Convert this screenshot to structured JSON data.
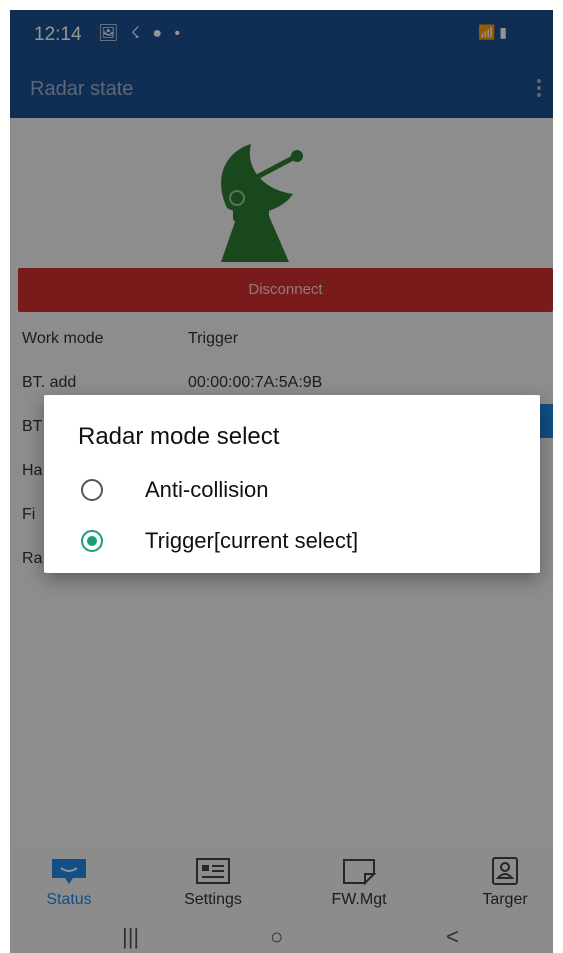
{
  "statusbar": {
    "time": "12:14",
    "left_icons": "🖼 ☇ ● •",
    "right_icons": "📶 ▮"
  },
  "appbar": {
    "title": "Radar state"
  },
  "radar": {
    "disconnect_label": "Disconnect"
  },
  "info": [
    {
      "label": "Work mode",
      "value": "Trigger"
    },
    {
      "label": "BT. add",
      "value": "00:00:00:7A:5A:9B"
    },
    {
      "label": "BT",
      "value": ""
    },
    {
      "label": "Ha",
      "value": ""
    },
    {
      "label": "Fi",
      "value": ""
    },
    {
      "label": "Ra",
      "value": ""
    }
  ],
  "dialog": {
    "title": "Radar mode select",
    "options": [
      {
        "label": "Anti-collision",
        "selected": false
      },
      {
        "label": "Trigger[current select]",
        "selected": true
      }
    ]
  },
  "bottom_nav": [
    {
      "label": "Status",
      "icon": "chat-bubble-icon",
      "active": true
    },
    {
      "label": "Settings",
      "icon": "id-card-icon",
      "active": false
    },
    {
      "label": "FW.Mgt",
      "icon": "firmware-icon",
      "active": false
    },
    {
      "label": "Targer",
      "icon": "target-profile-icon",
      "active": false
    }
  ],
  "system_nav": {
    "recents": "|||",
    "home": "○",
    "back": "<"
  },
  "colors": {
    "primary": "#1d4f8f",
    "disconnect": "#d32f2f",
    "radar_green": "#2e7d32",
    "radio_accent": "#1a9e7a",
    "active_nav": "#1e88e5"
  }
}
